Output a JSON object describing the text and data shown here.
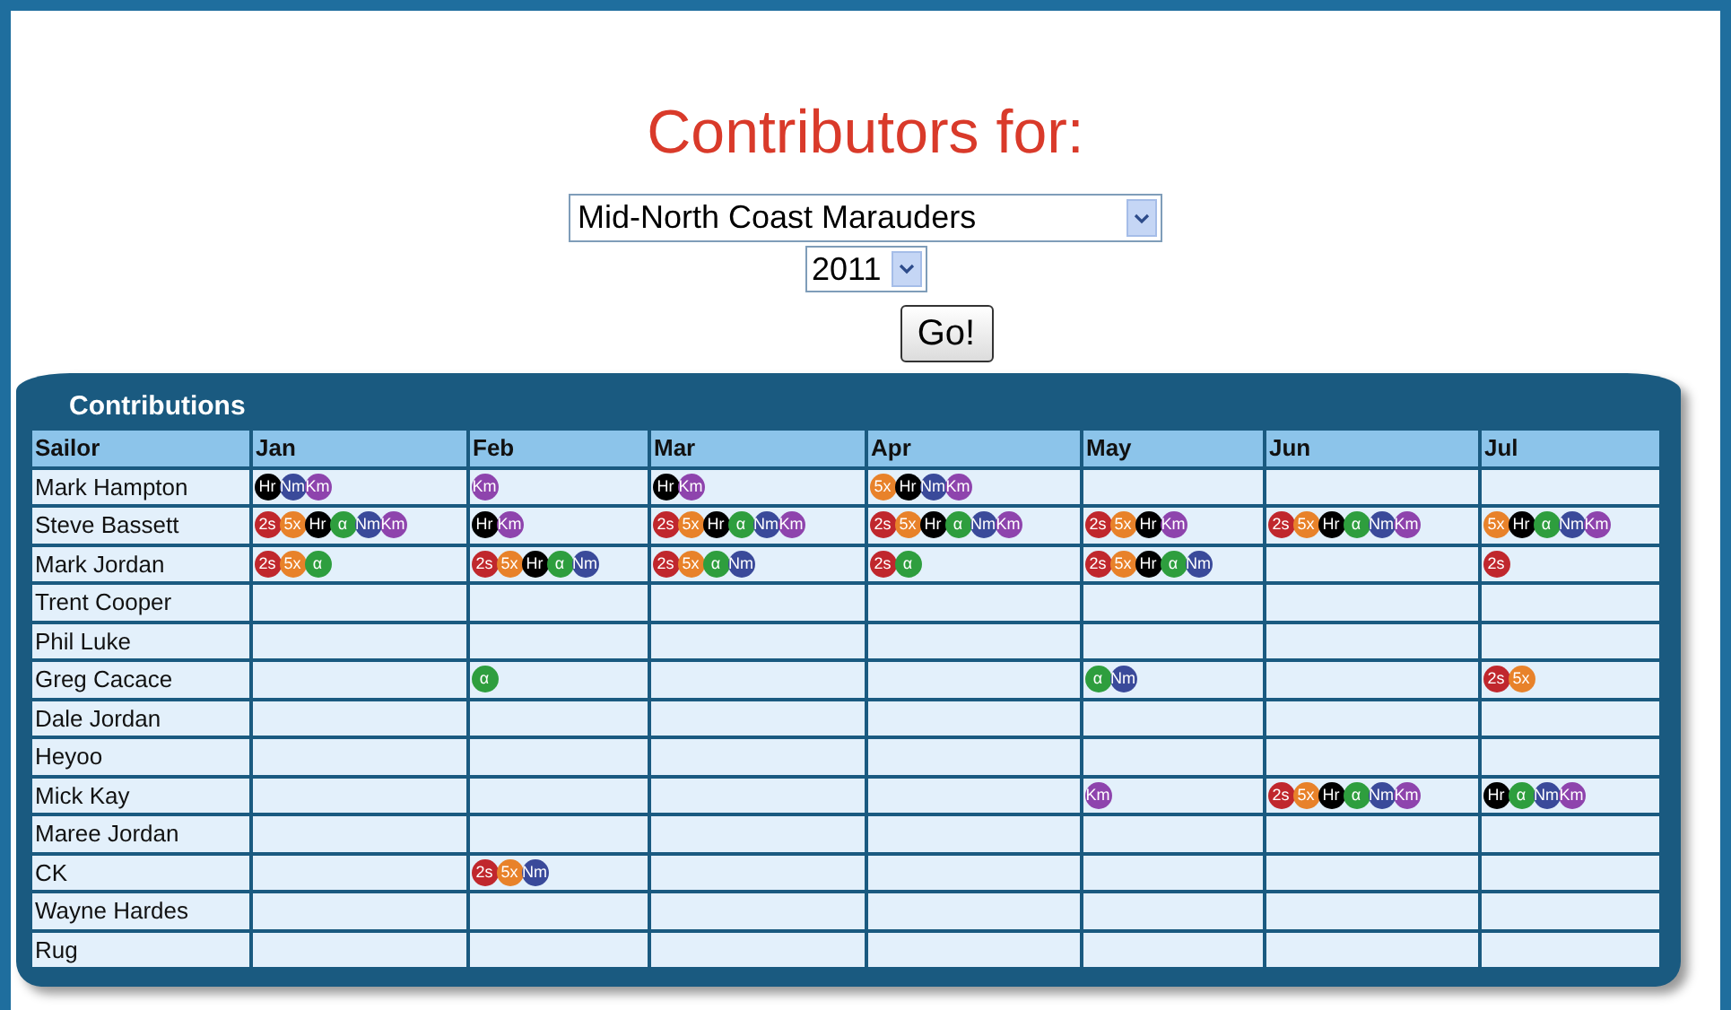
{
  "heading": "Contributors for:",
  "team_select": {
    "value": "Mid-North Coast Marauders"
  },
  "year_select": {
    "value": "2011"
  },
  "go_button": "Go!",
  "panel": {
    "title": "Contributions"
  },
  "table": {
    "columns": [
      "Sailor",
      "Jan",
      "Feb",
      "Mar",
      "Apr",
      "May",
      "Jun",
      "Jul"
    ],
    "rows": [
      {
        "cells": [
          "Mark Hampton",
          [
            {
              "label": "Hr",
              "color": "#000000"
            },
            {
              "label": "Nm",
              "color": "#3a4a9a"
            },
            {
              "label": "Km",
              "color": "#8e44ad"
            }
          ],
          [
            {
              "label": "Km",
              "color": "#8e44ad"
            }
          ],
          [
            {
              "label": "Hr",
              "color": "#000000"
            },
            {
              "label": "Km",
              "color": "#8e44ad"
            }
          ],
          [
            {
              "label": "5x",
              "color": "#e8822a"
            },
            {
              "label": "Hr",
              "color": "#000000"
            },
            {
              "label": "Nm",
              "color": "#3a4a9a"
            },
            {
              "label": "Km",
              "color": "#8e44ad"
            }
          ],
          "",
          "",
          ""
        ]
      },
      {
        "cells": [
          "Steve Bassett",
          [
            {
              "label": "2s",
              "color": "#c0272d"
            },
            {
              "label": "5x",
              "color": "#e8822a"
            },
            {
              "label": "Hr",
              "color": "#000000"
            },
            {
              "label": "α",
              "color": "#2e9e3e"
            },
            {
              "label": "Nm",
              "color": "#3a4a9a"
            },
            {
              "label": "Km",
              "color": "#8e44ad"
            }
          ],
          [
            {
              "label": "Hr",
              "color": "#000000"
            },
            {
              "label": "Km",
              "color": "#8e44ad"
            }
          ],
          [
            {
              "label": "2s",
              "color": "#c0272d"
            },
            {
              "label": "5x",
              "color": "#e8822a"
            },
            {
              "label": "Hr",
              "color": "#000000"
            },
            {
              "label": "α",
              "color": "#2e9e3e"
            },
            {
              "label": "Nm",
              "color": "#3a4a9a"
            },
            {
              "label": "Km",
              "color": "#8e44ad"
            }
          ],
          [
            {
              "label": "2s",
              "color": "#c0272d"
            },
            {
              "label": "5x",
              "color": "#e8822a"
            },
            {
              "label": "Hr",
              "color": "#000000"
            },
            {
              "label": "α",
              "color": "#2e9e3e"
            },
            {
              "label": "Nm",
              "color": "#3a4a9a"
            },
            {
              "label": "Km",
              "color": "#8e44ad"
            }
          ],
          [
            {
              "label": "2s",
              "color": "#c0272d"
            },
            {
              "label": "5x",
              "color": "#e8822a"
            },
            {
              "label": "Hr",
              "color": "#000000"
            },
            {
              "label": "Km",
              "color": "#8e44ad"
            }
          ],
          [
            {
              "label": "2s",
              "color": "#c0272d"
            },
            {
              "label": "5x",
              "color": "#e8822a"
            },
            {
              "label": "Hr",
              "color": "#000000"
            },
            {
              "label": "α",
              "color": "#2e9e3e"
            },
            {
              "label": "Nm",
              "color": "#3a4a9a"
            },
            {
              "label": "Km",
              "color": "#8e44ad"
            }
          ],
          [
            {
              "label": "5x",
              "color": "#e8822a"
            },
            {
              "label": "Hr",
              "color": "#000000"
            },
            {
              "label": "α",
              "color": "#2e9e3e"
            },
            {
              "label": "Nm",
              "color": "#3a4a9a"
            },
            {
              "label": "Km",
              "color": "#8e44ad"
            }
          ]
        ]
      },
      {
        "cells": [
          "Mark Jordan",
          [
            {
              "label": "2s",
              "color": "#c0272d"
            },
            {
              "label": "5x",
              "color": "#e8822a"
            },
            {
              "label": "α",
              "color": "#2e9e3e"
            }
          ],
          [
            {
              "label": "2s",
              "color": "#c0272d"
            },
            {
              "label": "5x",
              "color": "#e8822a"
            },
            {
              "label": "Hr",
              "color": "#000000"
            },
            {
              "label": "α",
              "color": "#2e9e3e"
            },
            {
              "label": "Nm",
              "color": "#3a4a9a"
            }
          ],
          [
            {
              "label": "2s",
              "color": "#c0272d"
            },
            {
              "label": "5x",
              "color": "#e8822a"
            },
            {
              "label": "α",
              "color": "#2e9e3e"
            },
            {
              "label": "Nm",
              "color": "#3a4a9a"
            }
          ],
          [
            {
              "label": "2s",
              "color": "#c0272d"
            },
            {
              "label": "α",
              "color": "#2e9e3e"
            }
          ],
          [
            {
              "label": "2s",
              "color": "#c0272d"
            },
            {
              "label": "5x",
              "color": "#e8822a"
            },
            {
              "label": "Hr",
              "color": "#000000"
            },
            {
              "label": "α",
              "color": "#2e9e3e"
            },
            {
              "label": "Nm",
              "color": "#3a4a9a"
            }
          ],
          "",
          [
            {
              "label": "2s",
              "color": "#c0272d"
            }
          ]
        ]
      },
      {
        "cells": [
          "Trent Cooper",
          "",
          "",
          "",
          "",
          "",
          "",
          ""
        ]
      },
      {
        "cells": [
          "Phil Luke",
          "",
          "",
          "",
          "",
          "",
          "",
          ""
        ]
      },
      {
        "cells": [
          "Greg Cacace",
          "",
          [
            {
              "label": "α",
              "color": "#2e9e3e"
            }
          ],
          "",
          "",
          [
            {
              "label": "α",
              "color": "#2e9e3e"
            },
            {
              "label": "Nm",
              "color": "#3a4a9a"
            }
          ],
          "",
          [
            {
              "label": "2s",
              "color": "#c0272d"
            },
            {
              "label": "5x",
              "color": "#e8822a"
            }
          ]
        ]
      },
      {
        "cells": [
          "Dale Jordan",
          "",
          "",
          "",
          "",
          "",
          "",
          ""
        ]
      },
      {
        "cells": [
          "Heyoo",
          "",
          "",
          "",
          "",
          "",
          "",
          ""
        ]
      },
      {
        "cells": [
          "Mick Kay",
          "",
          "",
          "",
          "",
          [
            {
              "label": "Km",
              "color": "#8e44ad"
            }
          ],
          [
            {
              "label": "2s",
              "color": "#c0272d"
            },
            {
              "label": "5x",
              "color": "#e8822a"
            },
            {
              "label": "Hr",
              "color": "#000000"
            },
            {
              "label": "α",
              "color": "#2e9e3e"
            },
            {
              "label": "Nm",
              "color": "#3a4a9a"
            },
            {
              "label": "Km",
              "color": "#8e44ad"
            }
          ],
          [
            {
              "label": "Hr",
              "color": "#000000"
            },
            {
              "label": "α",
              "color": "#2e9e3e"
            },
            {
              "label": "Nm",
              "color": "#3a4a9a"
            },
            {
              "label": "Km",
              "color": "#8e44ad"
            }
          ]
        ]
      },
      {
        "cells": [
          "Maree Jordan",
          "",
          "",
          "",
          "",
          "",
          "",
          ""
        ]
      },
      {
        "cells": [
          "CK",
          "",
          [
            {
              "label": "2s",
              "color": "#c0272d"
            },
            {
              "label": "5x",
              "color": "#e8822a"
            },
            {
              "label": "Nm",
              "color": "#3a4a9a"
            }
          ],
          "",
          "",
          "",
          "",
          ""
        ]
      },
      {
        "cells": [
          "Wayne Hardes",
          "",
          "",
          "",
          "",
          "",
          "",
          ""
        ]
      },
      {
        "cells": [
          "Rug",
          "",
          "",
          "",
          "",
          "",
          "",
          ""
        ]
      }
    ]
  }
}
